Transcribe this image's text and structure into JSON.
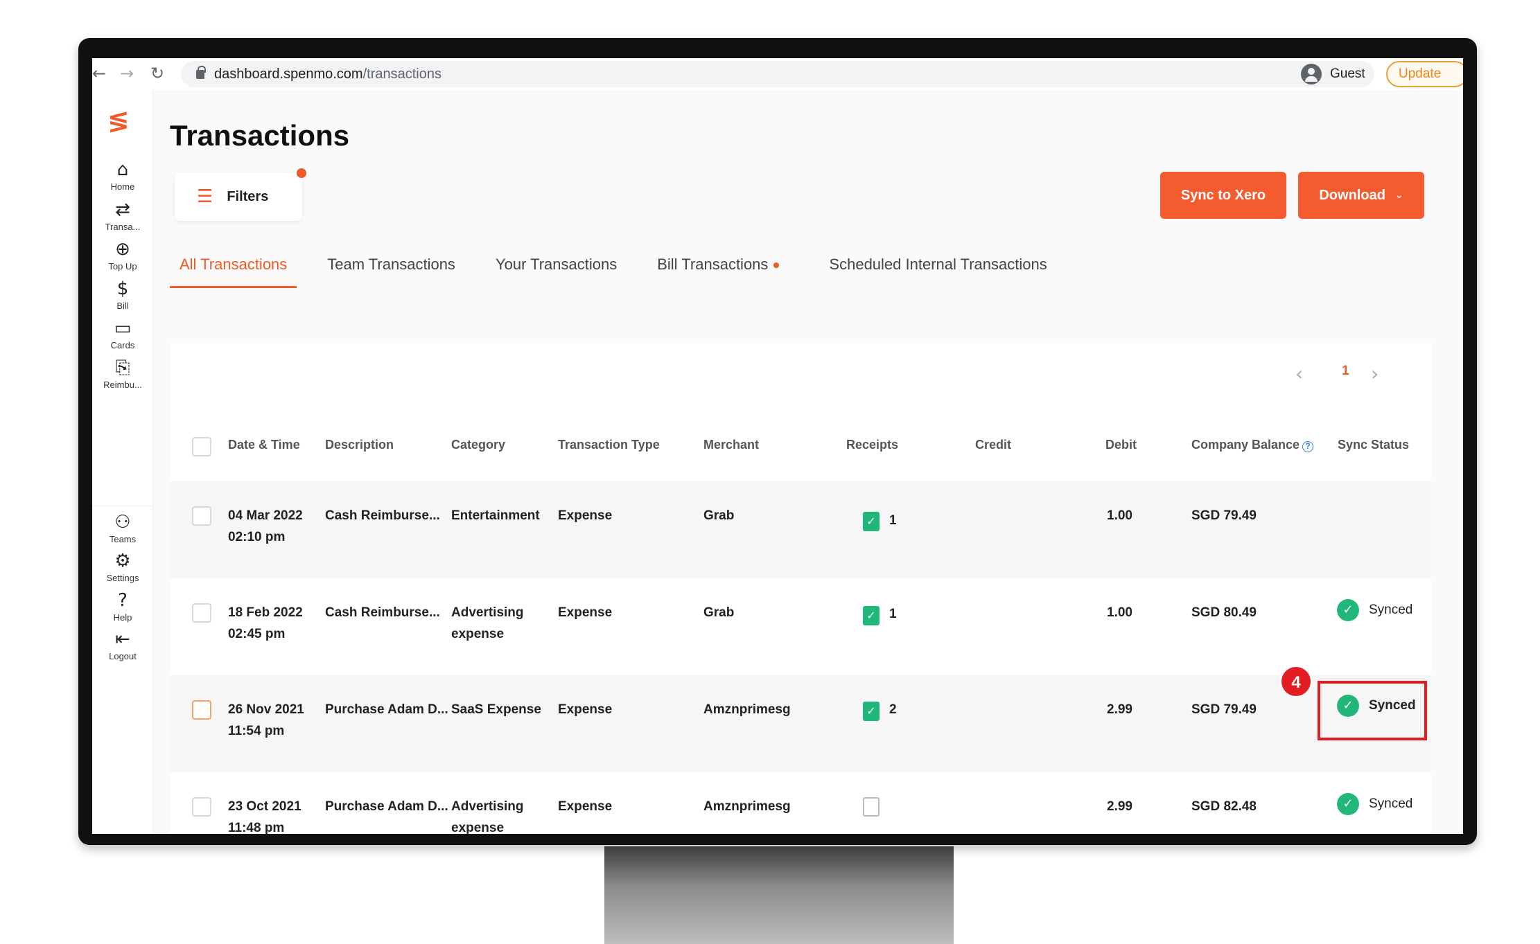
{
  "browser": {
    "url_host": "dashboard.spenmo.com",
    "url_path": "/transactions",
    "profile_label": "Guest",
    "update_label": "Update"
  },
  "sidebar": {
    "items": [
      {
        "label": "Home",
        "icon": "home-icon"
      },
      {
        "label": "Transa...",
        "icon": "transactions-icon"
      },
      {
        "label": "Top Up",
        "icon": "topup-icon"
      },
      {
        "label": "Bill",
        "icon": "bill-icon"
      },
      {
        "label": "Cards",
        "icon": "cards-icon"
      },
      {
        "label": "Reimbu...",
        "icon": "reimbursement-icon"
      },
      {
        "label": "Teams",
        "icon": "teams-icon"
      },
      {
        "label": "Settings",
        "icon": "settings-icon"
      },
      {
        "label": "Help",
        "icon": "help-icon"
      },
      {
        "label": "Logout",
        "icon": "logout-icon"
      }
    ]
  },
  "page": {
    "title": "Transactions",
    "filters_label": "Filters",
    "sync_label": "Sync to Xero",
    "download_label": "Download"
  },
  "tabs": [
    {
      "label": "All Transactions",
      "active": true
    },
    {
      "label": "Team Transactions"
    },
    {
      "label": "Your Transactions"
    },
    {
      "label": "Bill Transactions"
    },
    {
      "label": "Scheduled Internal Transactions"
    }
  ],
  "pagination": {
    "current": "1"
  },
  "table": {
    "headers": {
      "date": "Date & Time",
      "description": "Description",
      "category": "Category",
      "type": "Transaction Type",
      "merchant": "Merchant",
      "receipts": "Receipts",
      "credit": "Credit",
      "debit": "Debit",
      "balance": "Company Balance",
      "sync": "Sync Status"
    },
    "rows": [
      {
        "date": "04 Mar 2022",
        "time": "02:10 pm",
        "description": "Cash Reimburse...",
        "category": "Entertainment",
        "category2": "",
        "type": "Expense",
        "merchant": "Grab",
        "receipts": "1",
        "credit": "",
        "debit": "1.00",
        "balance": "SGD 79.49",
        "sync": ""
      },
      {
        "date": "18 Feb 2022",
        "time": "02:45 pm",
        "description": "Cash Reimburse...",
        "category": "Advertising",
        "category2": "expense",
        "type": "Expense",
        "merchant": "Grab",
        "receipts": "1",
        "credit": "",
        "debit": "1.00",
        "balance": "SGD 80.49",
        "sync": "Synced"
      },
      {
        "date": "26 Nov 2021",
        "time": "11:54 pm",
        "description": "Purchase Adam D...",
        "category": "SaaS Expense",
        "category2": "",
        "type": "Expense",
        "merchant": "Amznprimesg",
        "receipts": "2",
        "credit": "",
        "debit": "2.99",
        "balance": "SGD 79.49",
        "sync": "Synced"
      },
      {
        "date": "23 Oct 2021",
        "time": "11:48 pm",
        "description": "Purchase Adam D...",
        "category": "Advertising",
        "category2": "expense",
        "type": "Expense",
        "merchant": "Amznprimesg",
        "receipts": "",
        "credit": "",
        "debit": "2.99",
        "balance": "SGD 82.48",
        "sync": "Synced"
      }
    ]
  },
  "annotation": {
    "step": "4"
  },
  "colors": {
    "accent": "#f05a28",
    "synced": "#22b77a",
    "highlight": "#e31b23"
  }
}
